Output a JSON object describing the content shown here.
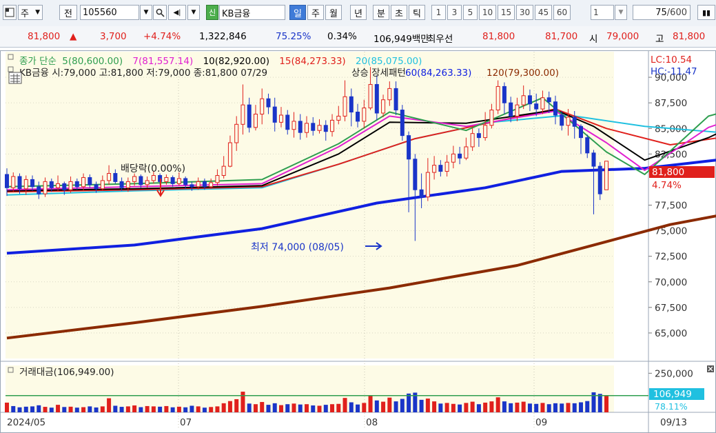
{
  "toolbar": {
    "period_label": "주",
    "prev_label": "전",
    "stock_code": "105560",
    "stock_name_badge": "신",
    "stock_name": "KB금융",
    "period_tabs": [
      "일",
      "주",
      "월",
      "년",
      "분",
      "초",
      "틱"
    ],
    "interval_buttons": [
      "1",
      "3",
      "5",
      "10",
      "15",
      "30",
      "45",
      "60"
    ],
    "interval_value": "1",
    "view_count": "75",
    "view_total": "/600"
  },
  "quote": {
    "price": "81,800",
    "arrow": "▲",
    "change": "3,700",
    "change_pct": "+4.74%",
    "volume": "1,322,846",
    "ratio1": "75.25%",
    "ratio2": "0.34%",
    "amount": "106,949백만",
    "best_label": "최우선",
    "best_ask": "81,800",
    "best_bid": "81,700",
    "open_label": "시",
    "open": "79,000",
    "high_label": "고",
    "high": "81,800"
  },
  "legend": {
    "ma_title": "종가 단순",
    "ma5": "5(80,600.00)",
    "ma7": "7(81,557.14)",
    "ma10": "10(82,920.00)",
    "ma15": "15(84,273.33)",
    "ma20": "20(85,075.00)",
    "ohlc": "KB금융 시:79,000 고:81,800 저:79,000 종:81,800 07/29",
    "overlap_text": "상승 장세패턴",
    "ma60": "60(84,263.33)",
    "ma120": "120(79,300.00)",
    "lc": "LC:10.54",
    "hc": "HC:-11.47",
    "volume_title": "거래대금(106,949.00)"
  },
  "annotations": {
    "dividend": "배당락(0.00%)",
    "low": "최저 74,000 (08/05)"
  },
  "price_tag": {
    "price": "81,800",
    "pct": "4.74%"
  },
  "volume_tag": {
    "value": "106,949",
    "pct": "78.11%"
  },
  "colors": {
    "up": "#e0201c",
    "down": "#1a35c8",
    "ma5": "#2e9e4f",
    "ma7": "#e020d0",
    "ma10": "#000000",
    "ma15": "#e0201c",
    "ma20": "#20c0e0",
    "ma60": "#1020e0",
    "ma120": "#8b2a00",
    "chart_bg": "#fdfbe6"
  },
  "chart_data": {
    "type": "candlestick",
    "y_axis_ticks": [
      "90,000",
      "87,500",
      "85,000",
      "82,500",
      "77,500",
      "75,000",
      "72,500",
      "70,000",
      "67,500",
      "65,000"
    ],
    "ylim": [
      62500,
      92500
    ],
    "x_axis_labels": [
      "2024/05",
      "07",
      "08",
      "09",
      "09/13"
    ],
    "volume_axis_ticks": [
      "250,000"
    ],
    "volume_ylim": [
      0,
      300000
    ],
    "volume_threshold": 106949,
    "ma120_points": [
      [
        0,
        64500
      ],
      [
        20,
        66000
      ],
      [
        40,
        67600
      ],
      [
        60,
        69400
      ],
      [
        80,
        71600
      ],
      [
        92,
        73600
      ],
      [
        104,
        75600
      ],
      [
        116,
        77000
      ],
      [
        126,
        78100
      ],
      [
        137,
        79000
      ],
      [
        145,
        79300
      ]
    ],
    "ma60_points": [
      [
        0,
        72800
      ],
      [
        20,
        73600
      ],
      [
        40,
        75200
      ],
      [
        58,
        77700
      ],
      [
        75,
        79200
      ],
      [
        87,
        80800
      ],
      [
        100,
        81100
      ],
      [
        114,
        82100
      ],
      [
        129,
        83900
      ],
      [
        145,
        84200
      ]
    ],
    "ma20_points": [
      [
        0,
        78500
      ],
      [
        20,
        78900
      ],
      [
        40,
        79200
      ],
      [
        52,
        81500
      ],
      [
        64,
        84000
      ],
      [
        76,
        85600
      ],
      [
        88,
        86300
      ],
      [
        100,
        85200
      ],
      [
        112,
        84600
      ],
      [
        124,
        84300
      ],
      [
        134,
        84600
      ],
      [
        145,
        84800
      ]
    ],
    "ma15_points": [
      [
        0,
        78800
      ],
      [
        20,
        79000
      ],
      [
        40,
        79300
      ],
      [
        52,
        81500
      ],
      [
        64,
        84000
      ],
      [
        76,
        85600
      ],
      [
        86,
        86900
      ],
      [
        94,
        85000
      ],
      [
        104,
        83400
      ],
      [
        115,
        84400
      ],
      [
        126,
        86200
      ],
      [
        134,
        87100
      ],
      [
        145,
        84600
      ]
    ],
    "ma10_points": [
      [
        0,
        78900
      ],
      [
        20,
        79100
      ],
      [
        40,
        79400
      ],
      [
        52,
        82500
      ],
      [
        60,
        85600
      ],
      [
        72,
        85500
      ],
      [
        86,
        86800
      ],
      [
        92,
        85200
      ],
      [
        100,
        81900
      ],
      [
        110,
        84100
      ],
      [
        120,
        87000
      ],
      [
        130,
        87400
      ],
      [
        140,
        84200
      ],
      [
        145,
        83000
      ]
    ],
    "ma7_points": [
      [
        0,
        79000
      ],
      [
        20,
        79300
      ],
      [
        40,
        79600
      ],
      [
        52,
        83200
      ],
      [
        60,
        86200
      ],
      [
        72,
        85200
      ],
      [
        86,
        86700
      ],
      [
        94,
        83600
      ],
      [
        100,
        80900
      ],
      [
        110,
        85100
      ],
      [
        120,
        87200
      ],
      [
        130,
        86900
      ],
      [
        140,
        83000
      ],
      [
        145,
        81600
      ]
    ],
    "ma5_points": [
      [
        0,
        79300
      ],
      [
        20,
        79600
      ],
      [
        40,
        80000
      ],
      [
        52,
        83500
      ],
      [
        60,
        86600
      ],
      [
        72,
        84800
      ],
      [
        84,
        88000
      ],
      [
        94,
        82700
      ],
      [
        100,
        80500
      ],
      [
        110,
        86200
      ],
      [
        120,
        87900
      ],
      [
        130,
        86800
      ],
      [
        140,
        81400
      ],
      [
        145,
        80600
      ]
    ],
    "candles": [
      [
        80500,
        79200,
        81100,
        78400
      ],
      [
        79200,
        80300,
        80700,
        78800
      ],
      [
        80300,
        79100,
        80600,
        78600
      ],
      [
        79100,
        80000,
        80400,
        78500
      ],
      [
        80000,
        79300,
        80400,
        78900
      ],
      [
        79300,
        78600,
        79800,
        78100
      ],
      [
        78600,
        79800,
        80200,
        78300
      ],
      [
        79800,
        79200,
        80100,
        78800
      ],
      [
        79200,
        79600,
        80400,
        78900
      ],
      [
        79600,
        79000,
        79800,
        78500
      ],
      [
        79000,
        79800,
        80300,
        78700
      ],
      [
        79800,
        79300,
        80100,
        79000
      ],
      [
        79300,
        80200,
        80600,
        78900
      ],
      [
        80200,
        79500,
        80500,
        79200
      ],
      [
        79500,
        79100,
        79800,
        78700
      ],
      [
        79100,
        79900,
        80400,
        78900
      ],
      [
        79900,
        80600,
        81400,
        79500
      ],
      [
        80600,
        79800,
        81000,
        79600
      ],
      [
        79800,
        79200,
        80200,
        78900
      ],
      [
        79200,
        79800,
        80200,
        78800
      ],
      [
        79800,
        80300,
        80600,
        79400
      ],
      [
        80300,
        79500,
        80500,
        79200
      ],
      [
        79500,
        79900,
        80300,
        79200
      ],
      [
        79900,
        80400,
        80800,
        79600
      ],
      [
        80400,
        79800,
        80600,
        79500
      ],
      [
        79800,
        80200,
        80500,
        79500
      ],
      [
        80200,
        79600,
        80400,
        79300
      ],
      [
        79600,
        80100,
        80700,
        79400
      ],
      [
        80100,
        79500,
        80300,
        79100
      ],
      [
        79500,
        79300,
        79800,
        78900
      ],
      [
        79300,
        79800,
        80200,
        79000
      ],
      [
        79800,
        79300,
        80100,
        79000
      ],
      [
        79300,
        79700,
        80100,
        79100
      ],
      [
        79700,
        80400,
        81000,
        79400
      ],
      [
        80400,
        81300,
        82300,
        80100
      ],
      [
        81300,
        83600,
        84300,
        81200
      ],
      [
        83600,
        85400,
        86200,
        82800
      ],
      [
        85400,
        87300,
        89300,
        84400
      ],
      [
        87300,
        85100,
        88000,
        84600
      ],
      [
        85100,
        86400,
        87300,
        84800
      ],
      [
        86400,
        87900,
        88900,
        85400
      ],
      [
        87900,
        87100,
        88400,
        86400
      ],
      [
        87100,
        85600,
        88000,
        84700
      ],
      [
        85600,
        86300,
        87100,
        85100
      ],
      [
        86300,
        84900,
        86800,
        84400
      ],
      [
        84900,
        85700,
        86600,
        84100
      ],
      [
        85700,
        84600,
        86400,
        83900
      ],
      [
        84600,
        85500,
        86200,
        84100
      ],
      [
        85500,
        84800,
        86100,
        84300
      ],
      [
        84800,
        85300,
        85900,
        84500
      ],
      [
        85300,
        84700,
        85800,
        83800
      ],
      [
        84700,
        85800,
        86400,
        84200
      ],
      [
        85800,
        86200,
        87200,
        85400
      ],
      [
        86200,
        88100,
        89700,
        85700
      ],
      [
        88100,
        86600,
        88900,
        85200
      ],
      [
        86600,
        85700,
        87400,
        85100
      ],
      [
        85700,
        87000,
        87800,
        85000
      ],
      [
        87000,
        89300,
        91000,
        86800
      ],
      [
        89300,
        86500,
        90200,
        85800
      ],
      [
        86500,
        87800,
        88300,
        86100
      ],
      [
        87800,
        88900,
        89600,
        87200
      ],
      [
        88900,
        86800,
        89600,
        86300
      ],
      [
        86800,
        84300,
        87300,
        83800
      ],
      [
        84300,
        82000,
        84700,
        76800
      ],
      [
        82000,
        79000,
        82500,
        74000
      ],
      [
        79000,
        78300,
        80600,
        77200
      ],
      [
        78300,
        80700,
        82100,
        77900
      ],
      [
        80700,
        81400,
        82300,
        80000
      ],
      [
        81400,
        80800,
        81900,
        80300
      ],
      [
        80800,
        81700,
        82400,
        80300
      ],
      [
        81700,
        82500,
        83300,
        81100
      ],
      [
        82500,
        82100,
        83200,
        81500
      ],
      [
        82100,
        83200,
        84100,
        81900
      ],
      [
        83200,
        84500,
        85100,
        82800
      ],
      [
        84500,
        84100,
        85000,
        83200
      ],
      [
        84100,
        85300,
        86600,
        83800
      ],
      [
        85300,
        86800,
        87400,
        85000
      ],
      [
        86800,
        89100,
        89700,
        86400
      ],
      [
        89100,
        87500,
        89500,
        86400
      ],
      [
        87500,
        86200,
        88100,
        85600
      ],
      [
        86200,
        87300,
        88000,
        85700
      ],
      [
        87300,
        88200,
        89200,
        86900
      ],
      [
        88200,
        87400,
        88800,
        86700
      ],
      [
        87400,
        86900,
        88400,
        86200
      ],
      [
        86900,
        88000,
        88700,
        86400
      ],
      [
        88000,
        87600,
        88600,
        86500
      ],
      [
        87600,
        86300,
        88200,
        85400
      ],
      [
        86300,
        85300,
        86700,
        84800
      ],
      [
        85300,
        86100,
        86900,
        84300
      ],
      [
        86100,
        85200,
        86700,
        84000
      ],
      [
        85200,
        84100,
        85400,
        82500
      ],
      [
        84100,
        82600,
        84400,
        82100
      ],
      [
        82600,
        81300,
        82900,
        76600
      ],
      [
        81300,
        78600,
        81700,
        78000
      ],
      [
        79000,
        81800,
        81800,
        79000
      ]
    ],
    "volumes": [
      [
        62000,
        "up"
      ],
      [
        40000,
        "down"
      ],
      [
        32000,
        "down"
      ],
      [
        36000,
        "down"
      ],
      [
        38000,
        "down"
      ],
      [
        45000,
        "down"
      ],
      [
        35000,
        "up"
      ],
      [
        30000,
        "down"
      ],
      [
        48000,
        "up"
      ],
      [
        34000,
        "down"
      ],
      [
        36000,
        "up"
      ],
      [
        30000,
        "down"
      ],
      [
        33000,
        "up"
      ],
      [
        38000,
        "down"
      ],
      [
        31000,
        "down"
      ],
      [
        38000,
        "up"
      ],
      [
        90000,
        "up"
      ],
      [
        42000,
        "down"
      ],
      [
        35000,
        "down"
      ],
      [
        38000,
        "up"
      ],
      [
        44000,
        "up"
      ],
      [
        33000,
        "down"
      ],
      [
        40000,
        "up"
      ],
      [
        38000,
        "up"
      ],
      [
        36000,
        "down"
      ],
      [
        40000,
        "up"
      ],
      [
        32000,
        "down"
      ],
      [
        36000,
        "up"
      ],
      [
        32000,
        "down"
      ],
      [
        42000,
        "down"
      ],
      [
        38000,
        "up"
      ],
      [
        30000,
        "down"
      ],
      [
        34000,
        "up"
      ],
      [
        38000,
        "up"
      ],
      [
        58000,
        "up"
      ],
      [
        72000,
        "up"
      ],
      [
        84000,
        "up"
      ],
      [
        132000,
        "up"
      ],
      [
        56000,
        "down"
      ],
      [
        52000,
        "up"
      ],
      [
        66000,
        "up"
      ],
      [
        48000,
        "down"
      ],
      [
        58000,
        "down"
      ],
      [
        46000,
        "up"
      ],
      [
        52000,
        "down"
      ],
      [
        56000,
        "up"
      ],
      [
        50000,
        "down"
      ],
      [
        52000,
        "up"
      ],
      [
        44000,
        "down"
      ],
      [
        42000,
        "up"
      ],
      [
        48000,
        "down"
      ],
      [
        52000,
        "up"
      ],
      [
        54000,
        "up"
      ],
      [
        92000,
        "up"
      ],
      [
        64000,
        "down"
      ],
      [
        50000,
        "down"
      ],
      [
        60000,
        "up"
      ],
      [
        110000,
        "up"
      ],
      [
        76000,
        "down"
      ],
      [
        68000,
        "up"
      ],
      [
        94000,
        "up"
      ],
      [
        70000,
        "down"
      ],
      [
        86000,
        "down"
      ],
      [
        120000,
        "down"
      ],
      [
        126000,
        "down"
      ],
      [
        80000,
        "down"
      ],
      [
        88000,
        "up"
      ],
      [
        70000,
        "up"
      ],
      [
        56000,
        "down"
      ],
      [
        60000,
        "up"
      ],
      [
        54000,
        "up"
      ],
      [
        50000,
        "down"
      ],
      [
        60000,
        "up"
      ],
      [
        68000,
        "up"
      ],
      [
        52000,
        "down"
      ],
      [
        62000,
        "up"
      ],
      [
        70000,
        "up"
      ],
      [
        96000,
        "up"
      ],
      [
        70000,
        "down"
      ],
      [
        58000,
        "down"
      ],
      [
        62000,
        "up"
      ],
      [
        68000,
        "up"
      ],
      [
        56000,
        "down"
      ],
      [
        54000,
        "down"
      ],
      [
        60000,
        "up"
      ],
      [
        52000,
        "down"
      ],
      [
        58000,
        "down"
      ],
      [
        56000,
        "down"
      ],
      [
        60000,
        "up"
      ],
      [
        58000,
        "down"
      ],
      [
        64000,
        "down"
      ],
      [
        72000,
        "down"
      ],
      [
        128000,
        "down"
      ],
      [
        118000,
        "down"
      ],
      [
        106949,
        "up"
      ]
    ]
  }
}
